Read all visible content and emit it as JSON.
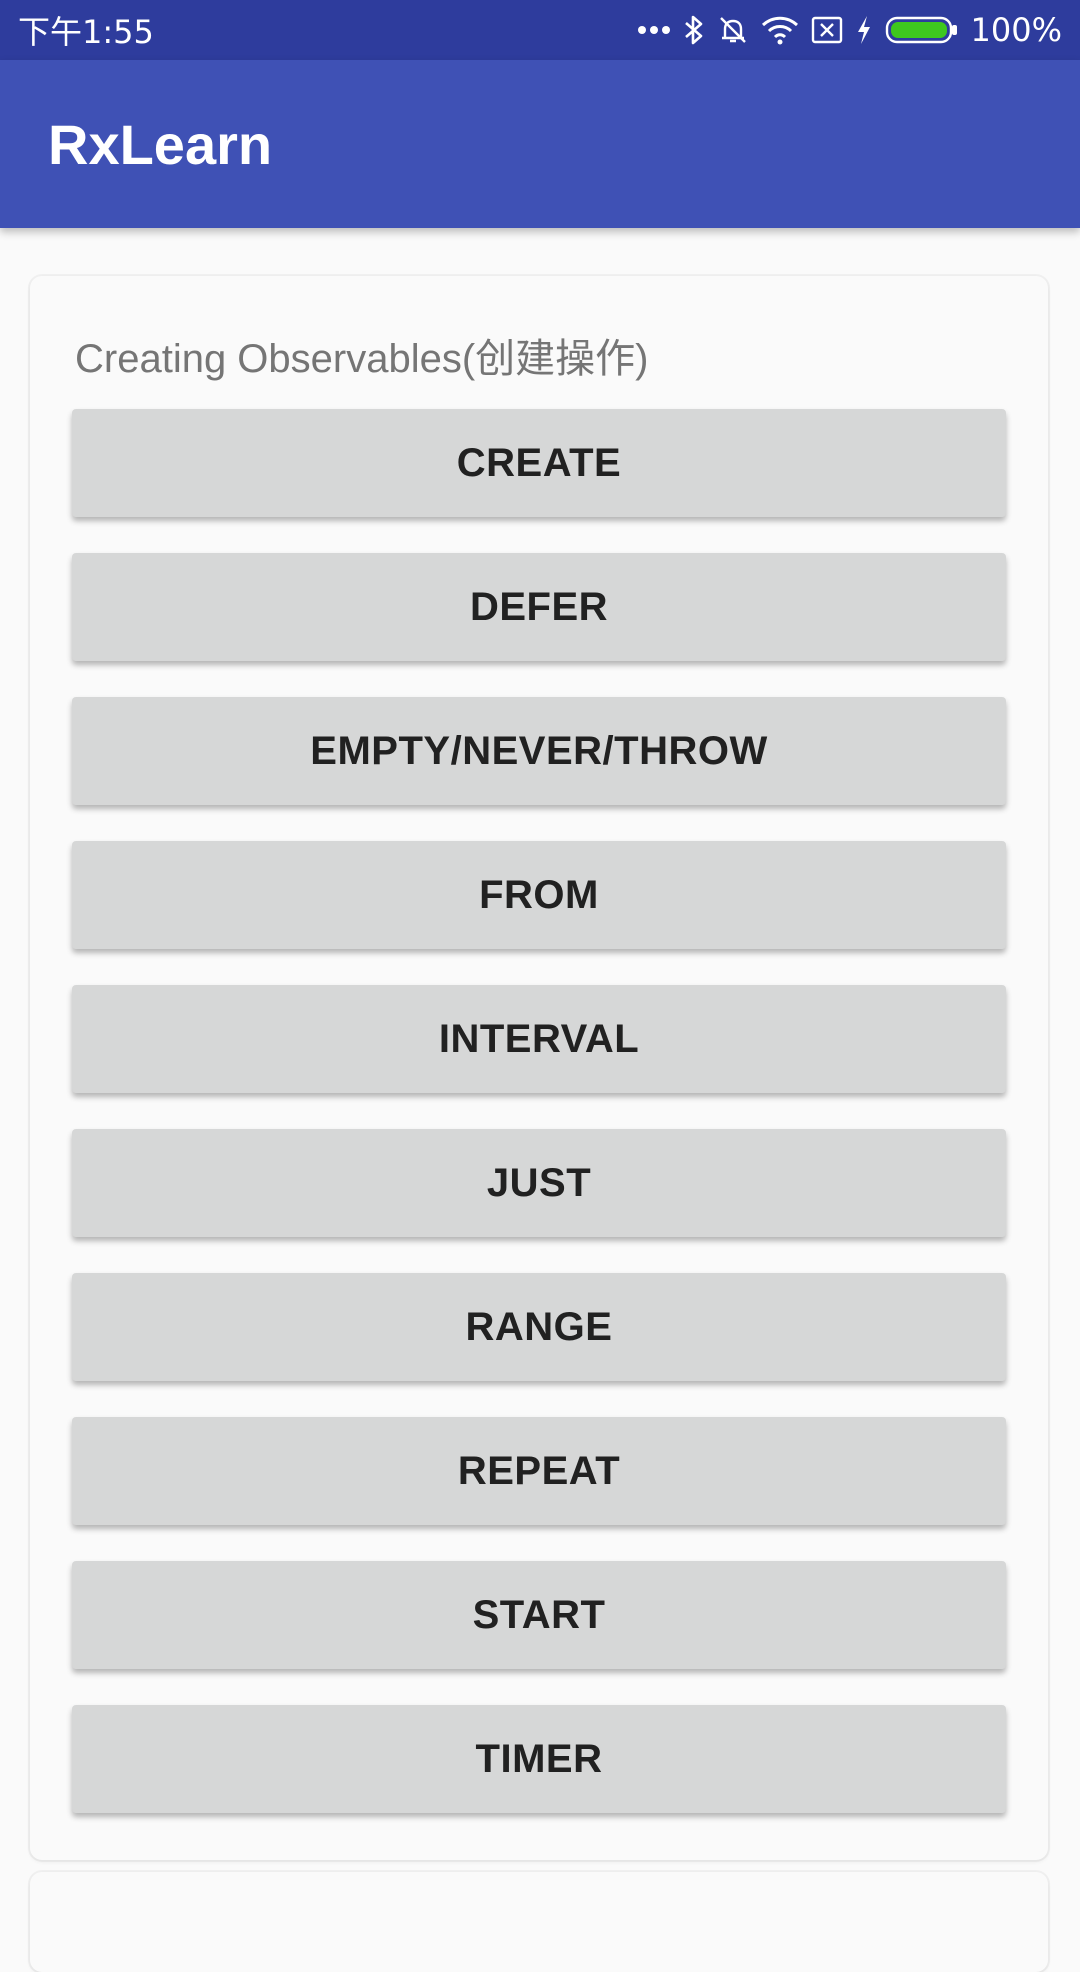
{
  "status_bar": {
    "time": "下午1:55",
    "battery_percent": "100%",
    "icons": [
      "more-dots-icon",
      "bluetooth-icon",
      "notifications-off-icon",
      "wifi-icon",
      "no-sim-icon",
      "charging-bolt-icon",
      "battery-icon"
    ],
    "battery_color": "#3ec81e"
  },
  "app_bar": {
    "title": "RxLearn",
    "color": "#3f51b5"
  },
  "section": {
    "title": "Creating Observables(创建操作)",
    "buttons": [
      {
        "label": "CREATE"
      },
      {
        "label": "DEFER"
      },
      {
        "label": "EMPTY/NEVER/THROW"
      },
      {
        "label": "FROM"
      },
      {
        "label": "INTERVAL"
      },
      {
        "label": "JUST"
      },
      {
        "label": "RANGE"
      },
      {
        "label": "REPEAT"
      },
      {
        "label": "START"
      },
      {
        "label": "TIMER"
      }
    ]
  }
}
